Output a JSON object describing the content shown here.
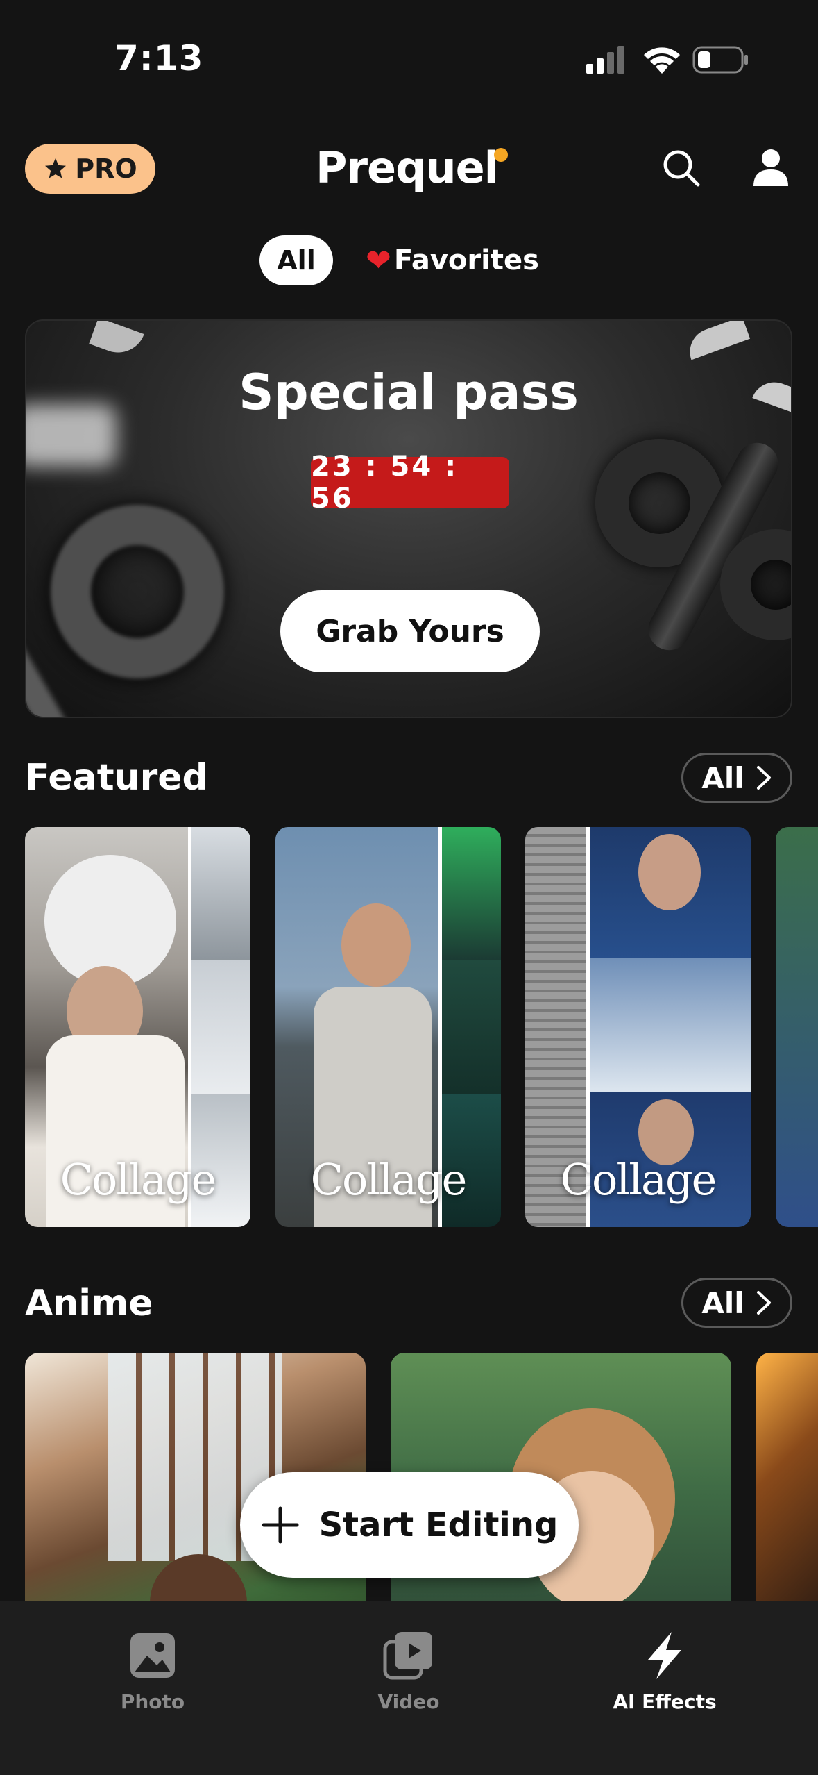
{
  "status_bar": {
    "time": "7:13"
  },
  "header": {
    "pro_label": "PRO",
    "logo": "Prequel"
  },
  "filters": {
    "all": "All",
    "favorites": "Favorites",
    "favorites_icon": "heart-icon"
  },
  "banner": {
    "title": "Special pass",
    "timer": "23 : 54 : 56",
    "button": "Grab Yours"
  },
  "featured": {
    "title": "Featured",
    "all_label": "All",
    "cards": [
      {
        "label": "Collage"
      },
      {
        "label": "Collage"
      },
      {
        "label": "Collage"
      }
    ]
  },
  "anime": {
    "title": "Anime",
    "all_label": "All"
  },
  "start_editing": "Start Editing",
  "tabs": [
    {
      "label": "Photo",
      "icon": "photo-icon",
      "active": false
    },
    {
      "label": "Video",
      "icon": "video-icon",
      "active": false
    },
    {
      "label": "AI Effects",
      "icon": "lightning-icon",
      "active": true
    }
  ],
  "colors": {
    "accent_pro": "#fbc28b",
    "timer_red": "#c51a1a",
    "logo_dot": "#f5a623",
    "background": "#141414"
  }
}
